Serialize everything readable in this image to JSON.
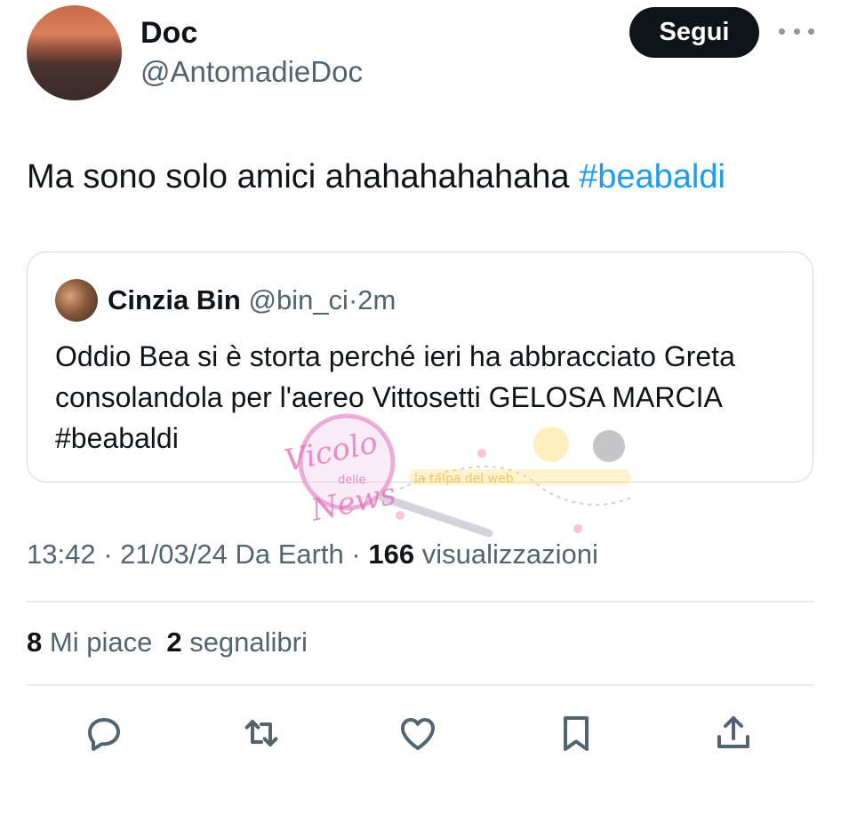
{
  "author": {
    "display_name": "Doc",
    "handle": "@AntomadieDoc",
    "follow_label": "Segui"
  },
  "tweet": {
    "text": "Ma sono solo amici ahahahahahaha ",
    "hashtag": "#beabaldi"
  },
  "quoted": {
    "name": "Cinzia Bin",
    "handle": "@bin_ci",
    "separator": "·",
    "time": "2m",
    "text": "Oddio Bea si è storta perché ieri ha abbracciato Greta consolandola per l'aereo Vittosetti GELOSA MARCIA #beabaldi"
  },
  "meta": {
    "time": "13:42",
    "date": "21/03/24",
    "source": "Da Earth",
    "separator": "·",
    "views_count": "166",
    "views_label": "visualizzazioni"
  },
  "stats": {
    "likes_count": "8",
    "likes_label": "Mi piace",
    "bookmarks_count": "2",
    "bookmarks_label": "segnalibri"
  },
  "watermark": {
    "line1": "Vicolo",
    "line2": "delle",
    "line3": "News",
    "site": "la talpa del web"
  },
  "icons": {
    "reply": "reply-icon",
    "retweet": "retweet-icon",
    "like": "heart-icon",
    "bookmark": "bookmark-icon",
    "share": "share-icon",
    "more": "more-icon"
  },
  "colors": {
    "text": "#0f1419",
    "secondary": "#536471",
    "hashtag": "#1d9bf0",
    "button": "#0f1419",
    "border": "#cfd9de"
  }
}
